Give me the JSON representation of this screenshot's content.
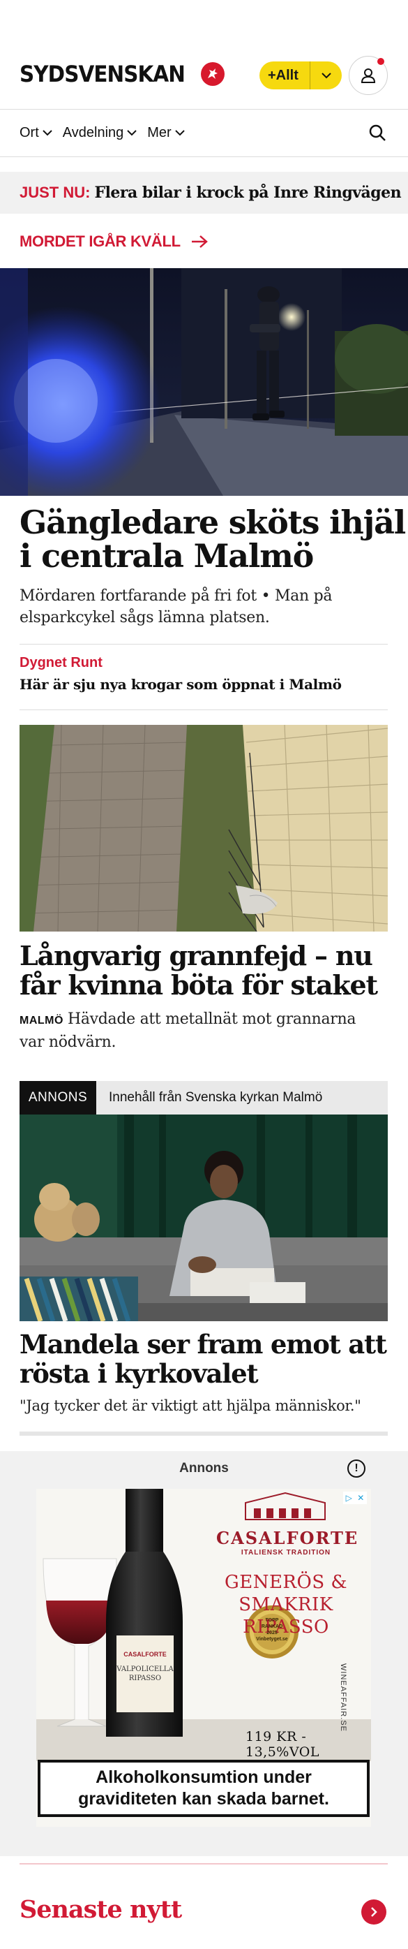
{
  "header": {
    "logo_text": "SYDSVENSKAN",
    "allt_label": "+Allt"
  },
  "nav": {
    "items": [
      {
        "label": "Ort"
      },
      {
        "label": "Avdelning"
      },
      {
        "label": "Mer"
      }
    ]
  },
  "breaking": {
    "label": "JUST NU:",
    "text": "Flera bilar i krock på Inre Ringvägen"
  },
  "topic_link": {
    "label": "MORDET IGÅR KVÄLL"
  },
  "main_story": {
    "headline_line1": "Gängledare sköts ihjäl",
    "headline_line2": "i centrala Malmö",
    "lede_line1": "Mördaren fortfarande på fri fot • Man på",
    "lede_line2": "elsparkcykel sågs lämna platsen."
  },
  "related": {
    "kicker": "Dygnet Runt",
    "headline": "Här är sju nya krogar som öppnat i Malmö"
  },
  "story2": {
    "headline_line1": "Långvarig grannfejd – nu",
    "headline_line2": "får kvinna böta för staket",
    "location": "MALMÖ",
    "lede_line1": "Hävdade att metallnät mot grannarna",
    "lede_line2": "var nödvärn."
  },
  "sponsored": {
    "tag": "ANNONS",
    "sponsor": "Innehåll från Svenska kyrkan Malmö",
    "headline_line1": "Mandela ser fram emot att",
    "headline_line2": "rösta i kyrkovalet",
    "lede": "\"Jag tycker det är viktigt att hjälpa människor.\""
  },
  "ad": {
    "header": "Annons",
    "info_symbol": "!",
    "brand": "CASALFORTE",
    "brand_sub": "ITALIENSK TRADITION",
    "slogan_line1": "GENERÖS &",
    "slogan_line2": "SMAKRIK",
    "slogan_line3": "RIPASSO",
    "badge_line1": "TOPP",
    "badge_line2": "RANKAD",
    "badge_line3": "2025",
    "badge_line4": "Vinbetyget.se",
    "label_brand": "CASALFORTE",
    "label_wine_line1": "VALPOLICELLA",
    "label_wine_line2": "RIPASSO",
    "price": "119 KR - 13,5%VOL",
    "site": "WINEAFFAIR.SE",
    "warning_line1": "Alkoholkonsumtion under",
    "warning_line2": "graviditeten kan skada barnet."
  },
  "latest": {
    "title": "Senaste nytt"
  },
  "colors": {
    "brand_red": "#d11a35",
    "allt_yellow": "#f6d90f"
  }
}
